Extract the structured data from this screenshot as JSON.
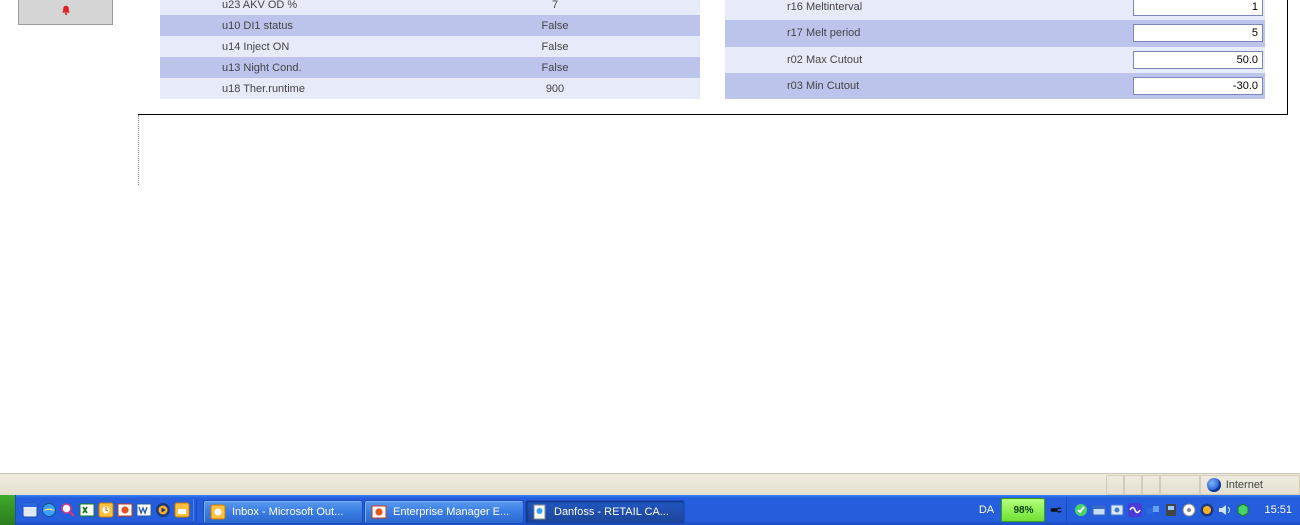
{
  "sidebar": {
    "icon": "bell-icon"
  },
  "left_table": {
    "rows": [
      {
        "label": "u23 AKV OD %",
        "value": "7"
      },
      {
        "label": "u10 DI1 status",
        "value": "False"
      },
      {
        "label": "u14 Inject ON",
        "value": "False"
      },
      {
        "label": "u13 Night Cond.",
        "value": "False"
      },
      {
        "label": "u18 Ther.runtime",
        "value": "900"
      }
    ]
  },
  "right_table": {
    "rows": [
      {
        "label": "r16 Meltinterval",
        "input": "1"
      },
      {
        "label": "r17 Melt period",
        "input": "5"
      },
      {
        "label": "r02 Max Cutout",
        "input": "50.0"
      },
      {
        "label": "r03 Min Cutout",
        "input": "-30.0"
      }
    ]
  },
  "ie_status": {
    "zone_label": "Internet"
  },
  "taskbar": {
    "buttons": [
      {
        "label": "Inbox - Microsoft Out...",
        "kind": "outlook",
        "active": false
      },
      {
        "label": "Enterprise Manager E...",
        "kind": "powerpoint",
        "active": false
      },
      {
        "label": "Danfoss - RETAIL CA...",
        "kind": "ie",
        "active": true
      }
    ],
    "lang": "DA",
    "battery": "98%",
    "clock": "15:51"
  }
}
